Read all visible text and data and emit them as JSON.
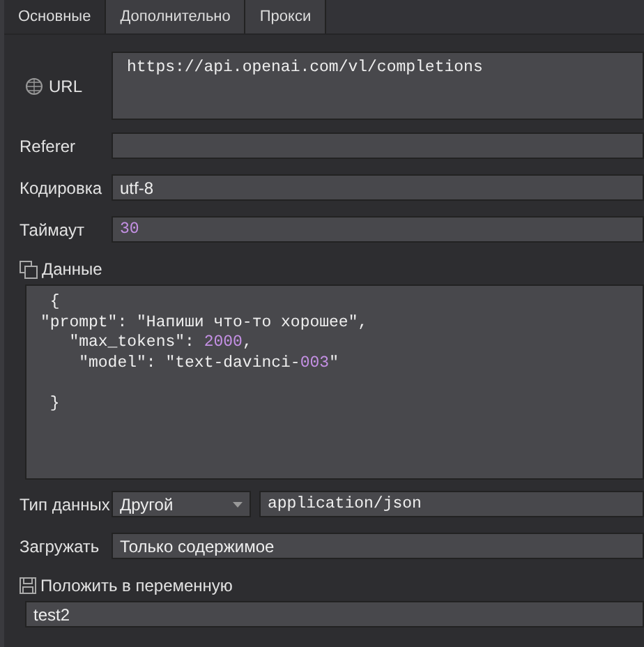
{
  "tabs": [
    {
      "label": "Основные",
      "selected": true
    },
    {
      "label": "Дополнительно",
      "selected": false
    },
    {
      "label": "Прокси",
      "selected": false
    }
  ],
  "url": {
    "label": "URL",
    "value": "https://api.openai.com/vl/completions"
  },
  "referer": {
    "label": "Referer"
  },
  "encoding": {
    "label": "Кодировка",
    "value": "utf-8"
  },
  "timeout": {
    "label": "Таймаут",
    "value": "30"
  },
  "data": {
    "label": "Данные",
    "lines": [
      [
        {
          "kind": "text",
          "text": " {"
        }
      ],
      [
        {
          "kind": "text",
          "text": "\"prompt\": \"Напиши что-то хорошее\","
        }
      ],
      [
        {
          "kind": "text",
          "text": "   \"max_tokens\": "
        },
        {
          "kind": "number",
          "text": "2000"
        },
        {
          "kind": "text",
          "text": ","
        }
      ],
      [
        {
          "kind": "text",
          "text": "    \"model\": \"text-davinci-"
        },
        {
          "kind": "number",
          "text": "003"
        },
        {
          "kind": "text",
          "text": "\""
        }
      ],
      [
        {
          "kind": "gap"
        },
        {
          "kind": "text",
          "text": " }"
        }
      ]
    ]
  },
  "data_type": {
    "label": "Тип данных",
    "selected": "Другой",
    "value": "application/json"
  },
  "load": {
    "label": "Загружать",
    "value": "Только содержимое"
  },
  "save_to": {
    "label": "Положить в переменную",
    "value": "test2"
  }
}
